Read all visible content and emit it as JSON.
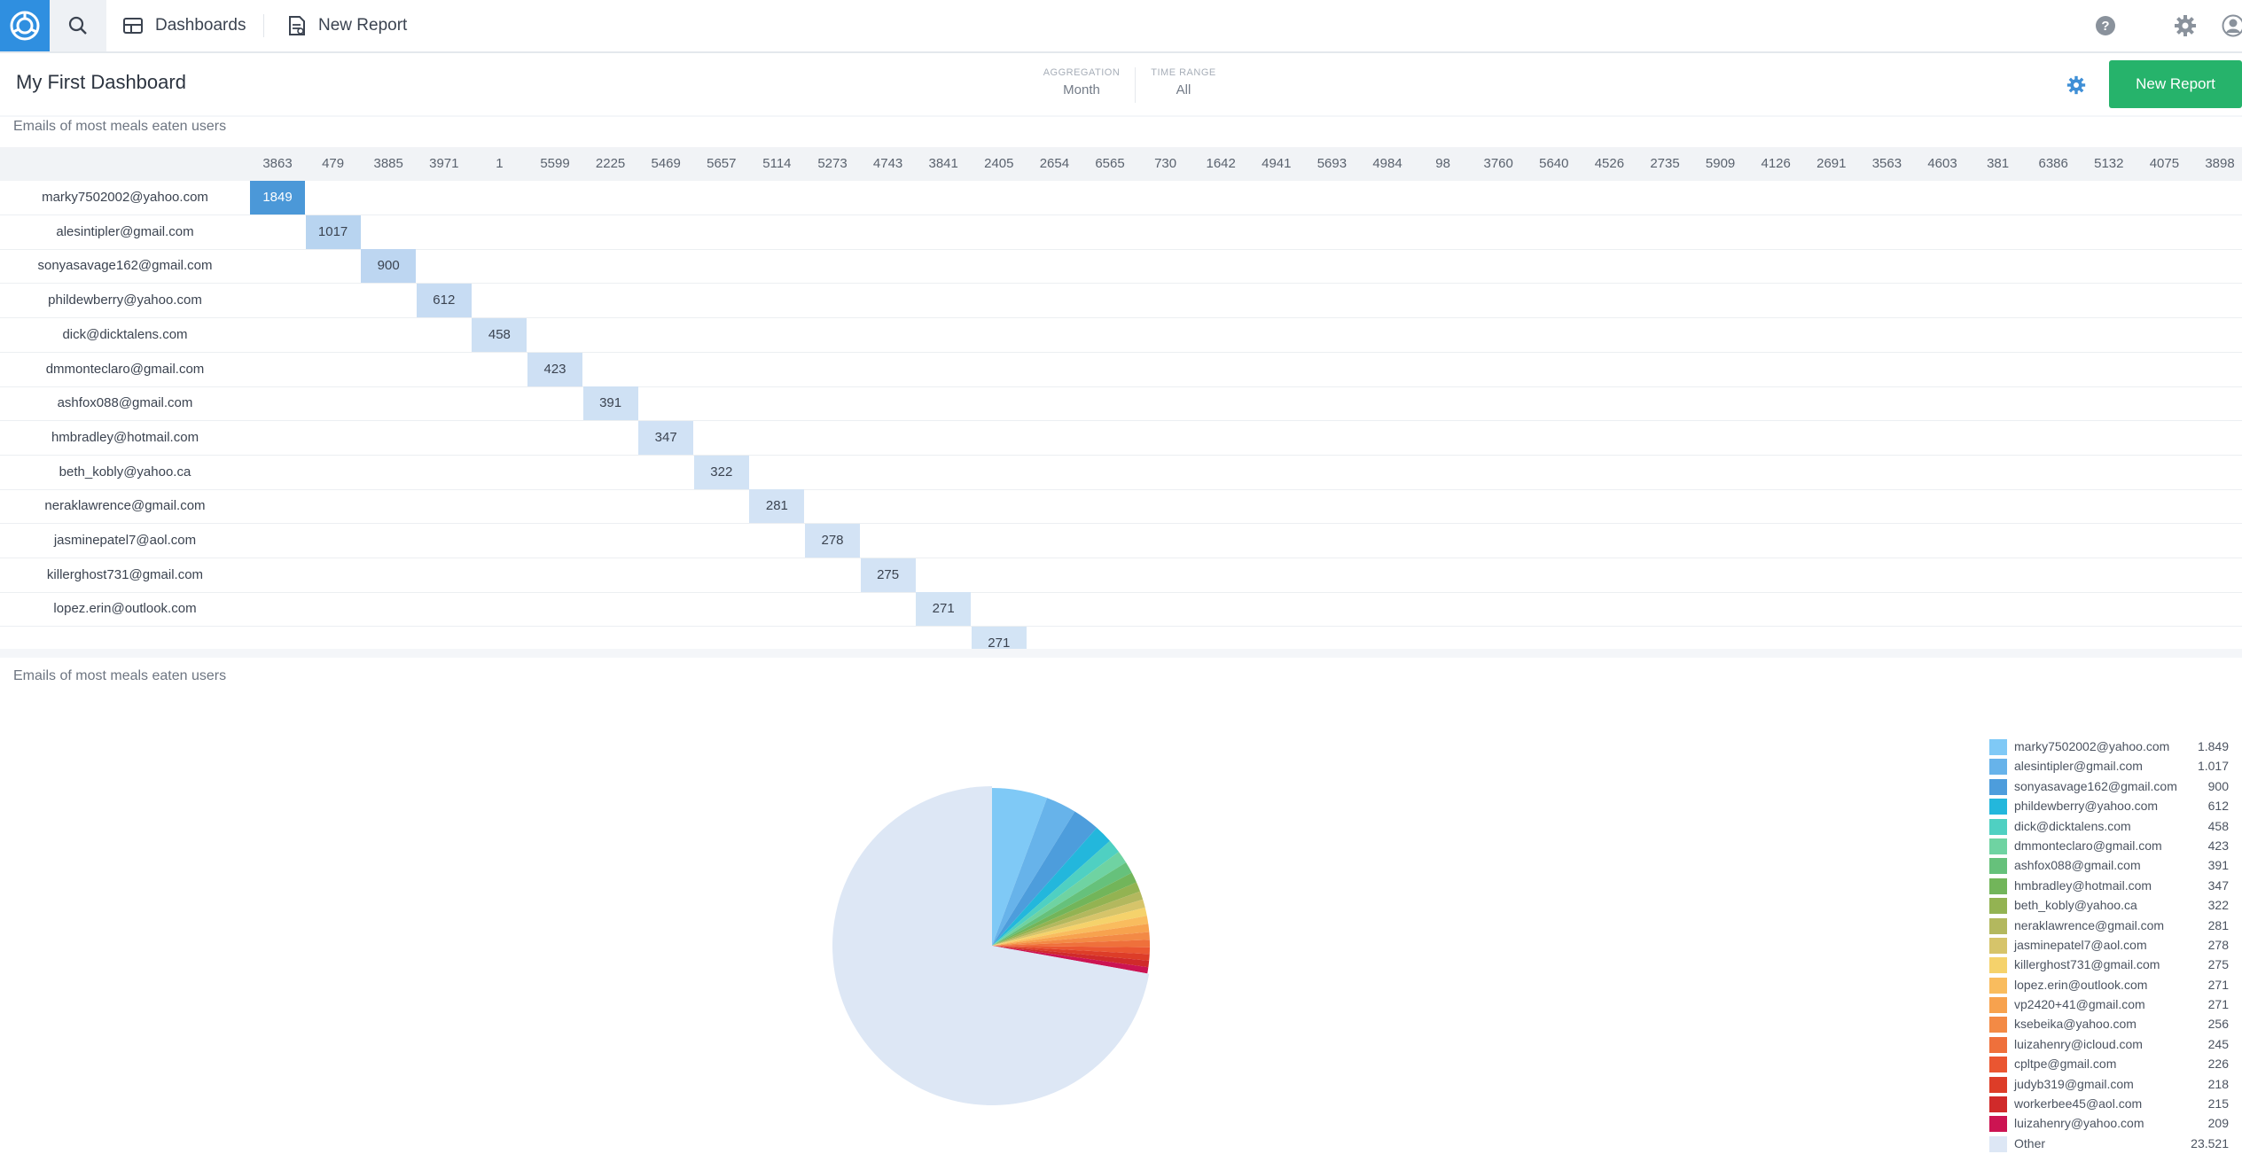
{
  "nav": {
    "dashboards_label": "Dashboards",
    "new_report_label": "New Report"
  },
  "dashboard": {
    "title": "My First Dashboard",
    "aggregation_label": "AGGREGATION",
    "aggregation_value": "Month",
    "time_range_label": "TIME RANGE",
    "time_range_value": "All",
    "new_report_button": "New Report"
  },
  "colors": {
    "brand_blue": "#2f8fe0",
    "button_green": "#26b36b"
  },
  "heat_panel": {
    "title": "Emails of most meals eaten users",
    "columns": [
      "3863",
      "479",
      "3885",
      "3971",
      "1",
      "5599",
      "2225",
      "5469",
      "5657",
      "5114",
      "5273",
      "4743",
      "3841",
      "2405",
      "2654",
      "6565",
      "730",
      "1642",
      "4941",
      "5693",
      "4984",
      "98",
      "3760",
      "5640",
      "4526",
      "2735",
      "5909",
      "4126",
      "2691",
      "3563",
      "4603",
      "381",
      "6386",
      "5132",
      "4075",
      "3898"
    ],
    "rows": [
      {
        "email": "marky7502002@yahoo.com",
        "value": "1849",
        "col": 0
      },
      {
        "email": "alesintipler@gmail.com",
        "value": "1017",
        "col": 1
      },
      {
        "email": "sonyasavage162@gmail.com",
        "value": "900",
        "col": 2
      },
      {
        "email": "phildewberry@yahoo.com",
        "value": "612",
        "col": 3
      },
      {
        "email": "dick@dicktalens.com",
        "value": "458",
        "col": 4
      },
      {
        "email": "dmmonteclaro@gmail.com",
        "value": "423",
        "col": 5
      },
      {
        "email": "ashfox088@gmail.com",
        "value": "391",
        "col": 6
      },
      {
        "email": "hmbradley@hotmail.com",
        "value": "347",
        "col": 7
      },
      {
        "email": "beth_kobly@yahoo.ca",
        "value": "322",
        "col": 8
      },
      {
        "email": "neraklawrence@gmail.com",
        "value": "281",
        "col": 9
      },
      {
        "email": "jasminepatel7@aol.com",
        "value": "278",
        "col": 10
      },
      {
        "email": "killerghost731@gmail.com",
        "value": "275",
        "col": 11
      },
      {
        "email": "lopez.erin@outlook.com",
        "value": "271",
        "col": 12
      },
      {
        "email": "",
        "value": "271",
        "col": 13
      }
    ]
  },
  "pie_panel": {
    "title": "Emails of most meals eaten users"
  },
  "chart_data": {
    "type": "pie",
    "title": "Emails of most meals eaten users",
    "slices": [
      {
        "label": "marky7502002@yahoo.com",
        "display": "1.849",
        "value": 1849,
        "color": "#7fc9f6"
      },
      {
        "label": "alesintipler@gmail.com",
        "display": "1.017",
        "value": 1017,
        "color": "#67b3ea"
      },
      {
        "label": "sonyasavage162@gmail.com",
        "display": "900",
        "value": 900,
        "color": "#4d9ddc"
      },
      {
        "label": "phildewberry@yahoo.com",
        "display": "612",
        "value": 612,
        "color": "#23b7dc"
      },
      {
        "label": "dick@dicktalens.com",
        "display": "458",
        "value": 458,
        "color": "#4fd0c2"
      },
      {
        "label": "dmmonteclaro@gmail.com",
        "display": "423",
        "value": 423,
        "color": "#6fd3a2"
      },
      {
        "label": "ashfox088@gmail.com",
        "display": "391",
        "value": 391,
        "color": "#66c17b"
      },
      {
        "label": "hmbradley@hotmail.com",
        "display": "347",
        "value": 347,
        "color": "#72b55a"
      },
      {
        "label": "beth_kobly@yahoo.ca",
        "display": "322",
        "value": 322,
        "color": "#93b352"
      },
      {
        "label": "neraklawrence@gmail.com",
        "display": "281",
        "value": 281,
        "color": "#b3b85e"
      },
      {
        "label": "jasminepatel7@aol.com",
        "display": "278",
        "value": 278,
        "color": "#d6c46a"
      },
      {
        "label": "killerghost731@gmail.com",
        "display": "275",
        "value": 275,
        "color": "#f5d26b"
      },
      {
        "label": "lopez.erin@outlook.com",
        "display": "271",
        "value": 271,
        "color": "#f9bc5e"
      },
      {
        "label": "vp2420+41@gmail.com",
        "display": "271",
        "value": 271,
        "color": "#f7a24e"
      },
      {
        "label": "ksebeika@yahoo.com",
        "display": "256",
        "value": 256,
        "color": "#f38a45"
      },
      {
        "label": "luizahenry@icloud.com",
        "display": "245",
        "value": 245,
        "color": "#ef703b"
      },
      {
        "label": "cpltpe@gmail.com",
        "display": "226",
        "value": 226,
        "color": "#ea5631"
      },
      {
        "label": "judyb319@gmail.com",
        "display": "218",
        "value": 218,
        "color": "#dd3d28"
      },
      {
        "label": "workerbee45@aol.com",
        "display": "215",
        "value": 215,
        "color": "#d02a2a"
      },
      {
        "label": "luizahenry@yahoo.com",
        "display": "209",
        "value": 209,
        "color": "#cc1452"
      },
      {
        "label": "Other",
        "display": "23.521",
        "value": 23521,
        "color": "#dde7f5"
      }
    ]
  }
}
